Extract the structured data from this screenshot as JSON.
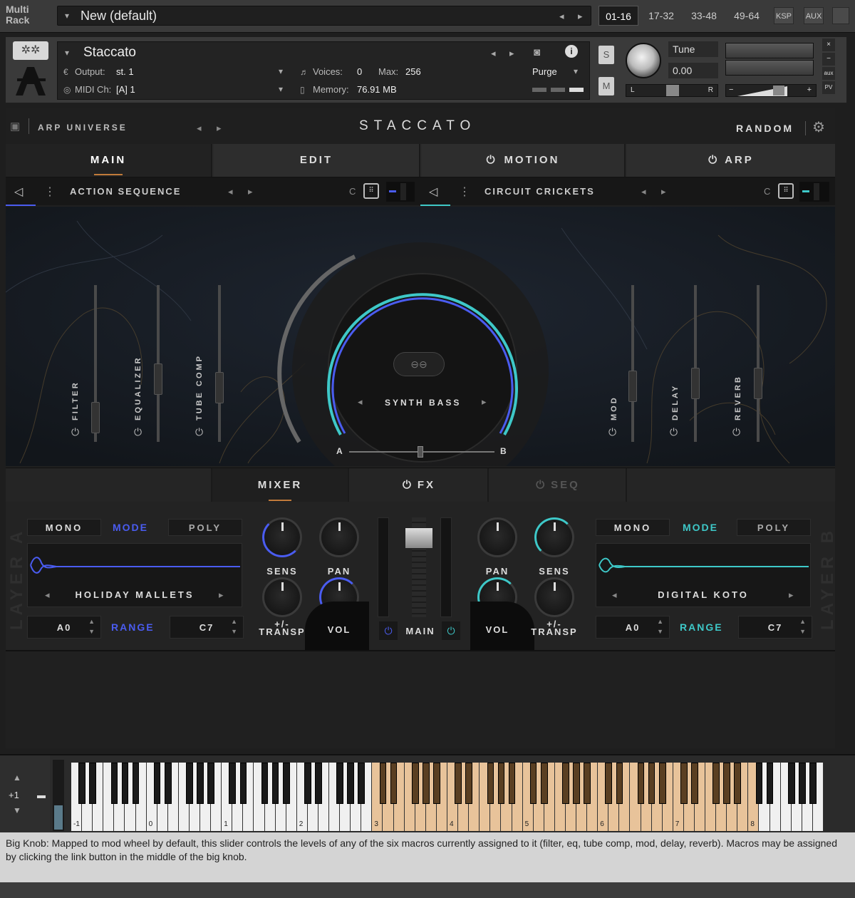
{
  "rack": {
    "label_line1": "Multi",
    "label_line2": "Rack",
    "preset_name": "New (default)",
    "tabs": [
      "01-16",
      "17-32",
      "33-48",
      "49-64"
    ],
    "ksp": "KSP",
    "aux": "AUX"
  },
  "instrument": {
    "name": "Staccato",
    "output_label": "Output:",
    "output_value": "st. 1",
    "midi_label": "MIDI Ch:",
    "midi_value": "[A]  1",
    "voices_label": "Voices:",
    "voices_value": "0",
    "max_label": "Max:",
    "max_value": "256",
    "memory_label": "Memory:",
    "memory_value": "76.91 MB",
    "purge_label": "Purge",
    "solo": "S",
    "mute": "M",
    "tune_label": "Tune",
    "tune_value": "0.00",
    "pan_left": "L",
    "pan_right": "R",
    "aux_label": "aux",
    "pv_label": "PV",
    "close": "×",
    "minimize": "−"
  },
  "plugin": {
    "bank_name": "ARP UNIVERSE",
    "title": "STACCATO",
    "random_label": "RANDOM",
    "tabs": {
      "main": "MAIN",
      "edit": "EDIT",
      "motion": "MOTION",
      "arp": "ARP"
    },
    "layer_a_sequence": "ACTION SEQUENCE",
    "layer_b_sequence": "CIRCUIT CRICKETS",
    "c_label": "C",
    "macros_left": [
      "FILTER",
      "EQUALIZER",
      "TUBE COMP"
    ],
    "macros_right": [
      "MOD",
      "DELAY",
      "REVERB"
    ],
    "big_knob_name": "SYNTH BASS",
    "ab_a": "A",
    "ab_b": "B",
    "mix_tabs": {
      "mixer": "MIXER",
      "fx": "FX",
      "seq": "SEQ"
    },
    "layer_a": {
      "side_label": "LAYER A",
      "mono": "MONO",
      "mode": "MODE",
      "poly": "POLY",
      "instrument": "HOLIDAY MALLETS",
      "range_low": "A0",
      "range": "RANGE",
      "range_high": "C7",
      "sens": "SENS",
      "pan": "PAN",
      "transp": "+/-\nTRANSP",
      "vol": "VOL"
    },
    "layer_b": {
      "side_label": "LAYER B",
      "mono": "MONO",
      "mode": "MODE",
      "poly": "POLY",
      "instrument": "DIGITAL KOTO",
      "range_low": "A0",
      "range": "RANGE",
      "range_high": "C7",
      "sens": "SENS",
      "pan": "PAN",
      "transp": "+/-\nTRANSP",
      "vol": "VOL"
    },
    "main_label": "MAIN",
    "colors": {
      "layer_a": "#4a5cf0",
      "layer_b": "#3ec8c8",
      "accent": "#c07a3a"
    }
  },
  "keyboard": {
    "octave_shift": "+1",
    "octave_labels": [
      "-1",
      "0",
      "1",
      "2",
      "3",
      "4",
      "5",
      "6",
      "7",
      "8"
    ]
  },
  "info_text": "Big Knob: Mapped to mod wheel by default, this slider controls the levels of any of the six macros currently assigned to it (filter, eq, tube comp, mod, delay, reverb). Macros may be assigned by clicking the link button in the middle of the big knob."
}
